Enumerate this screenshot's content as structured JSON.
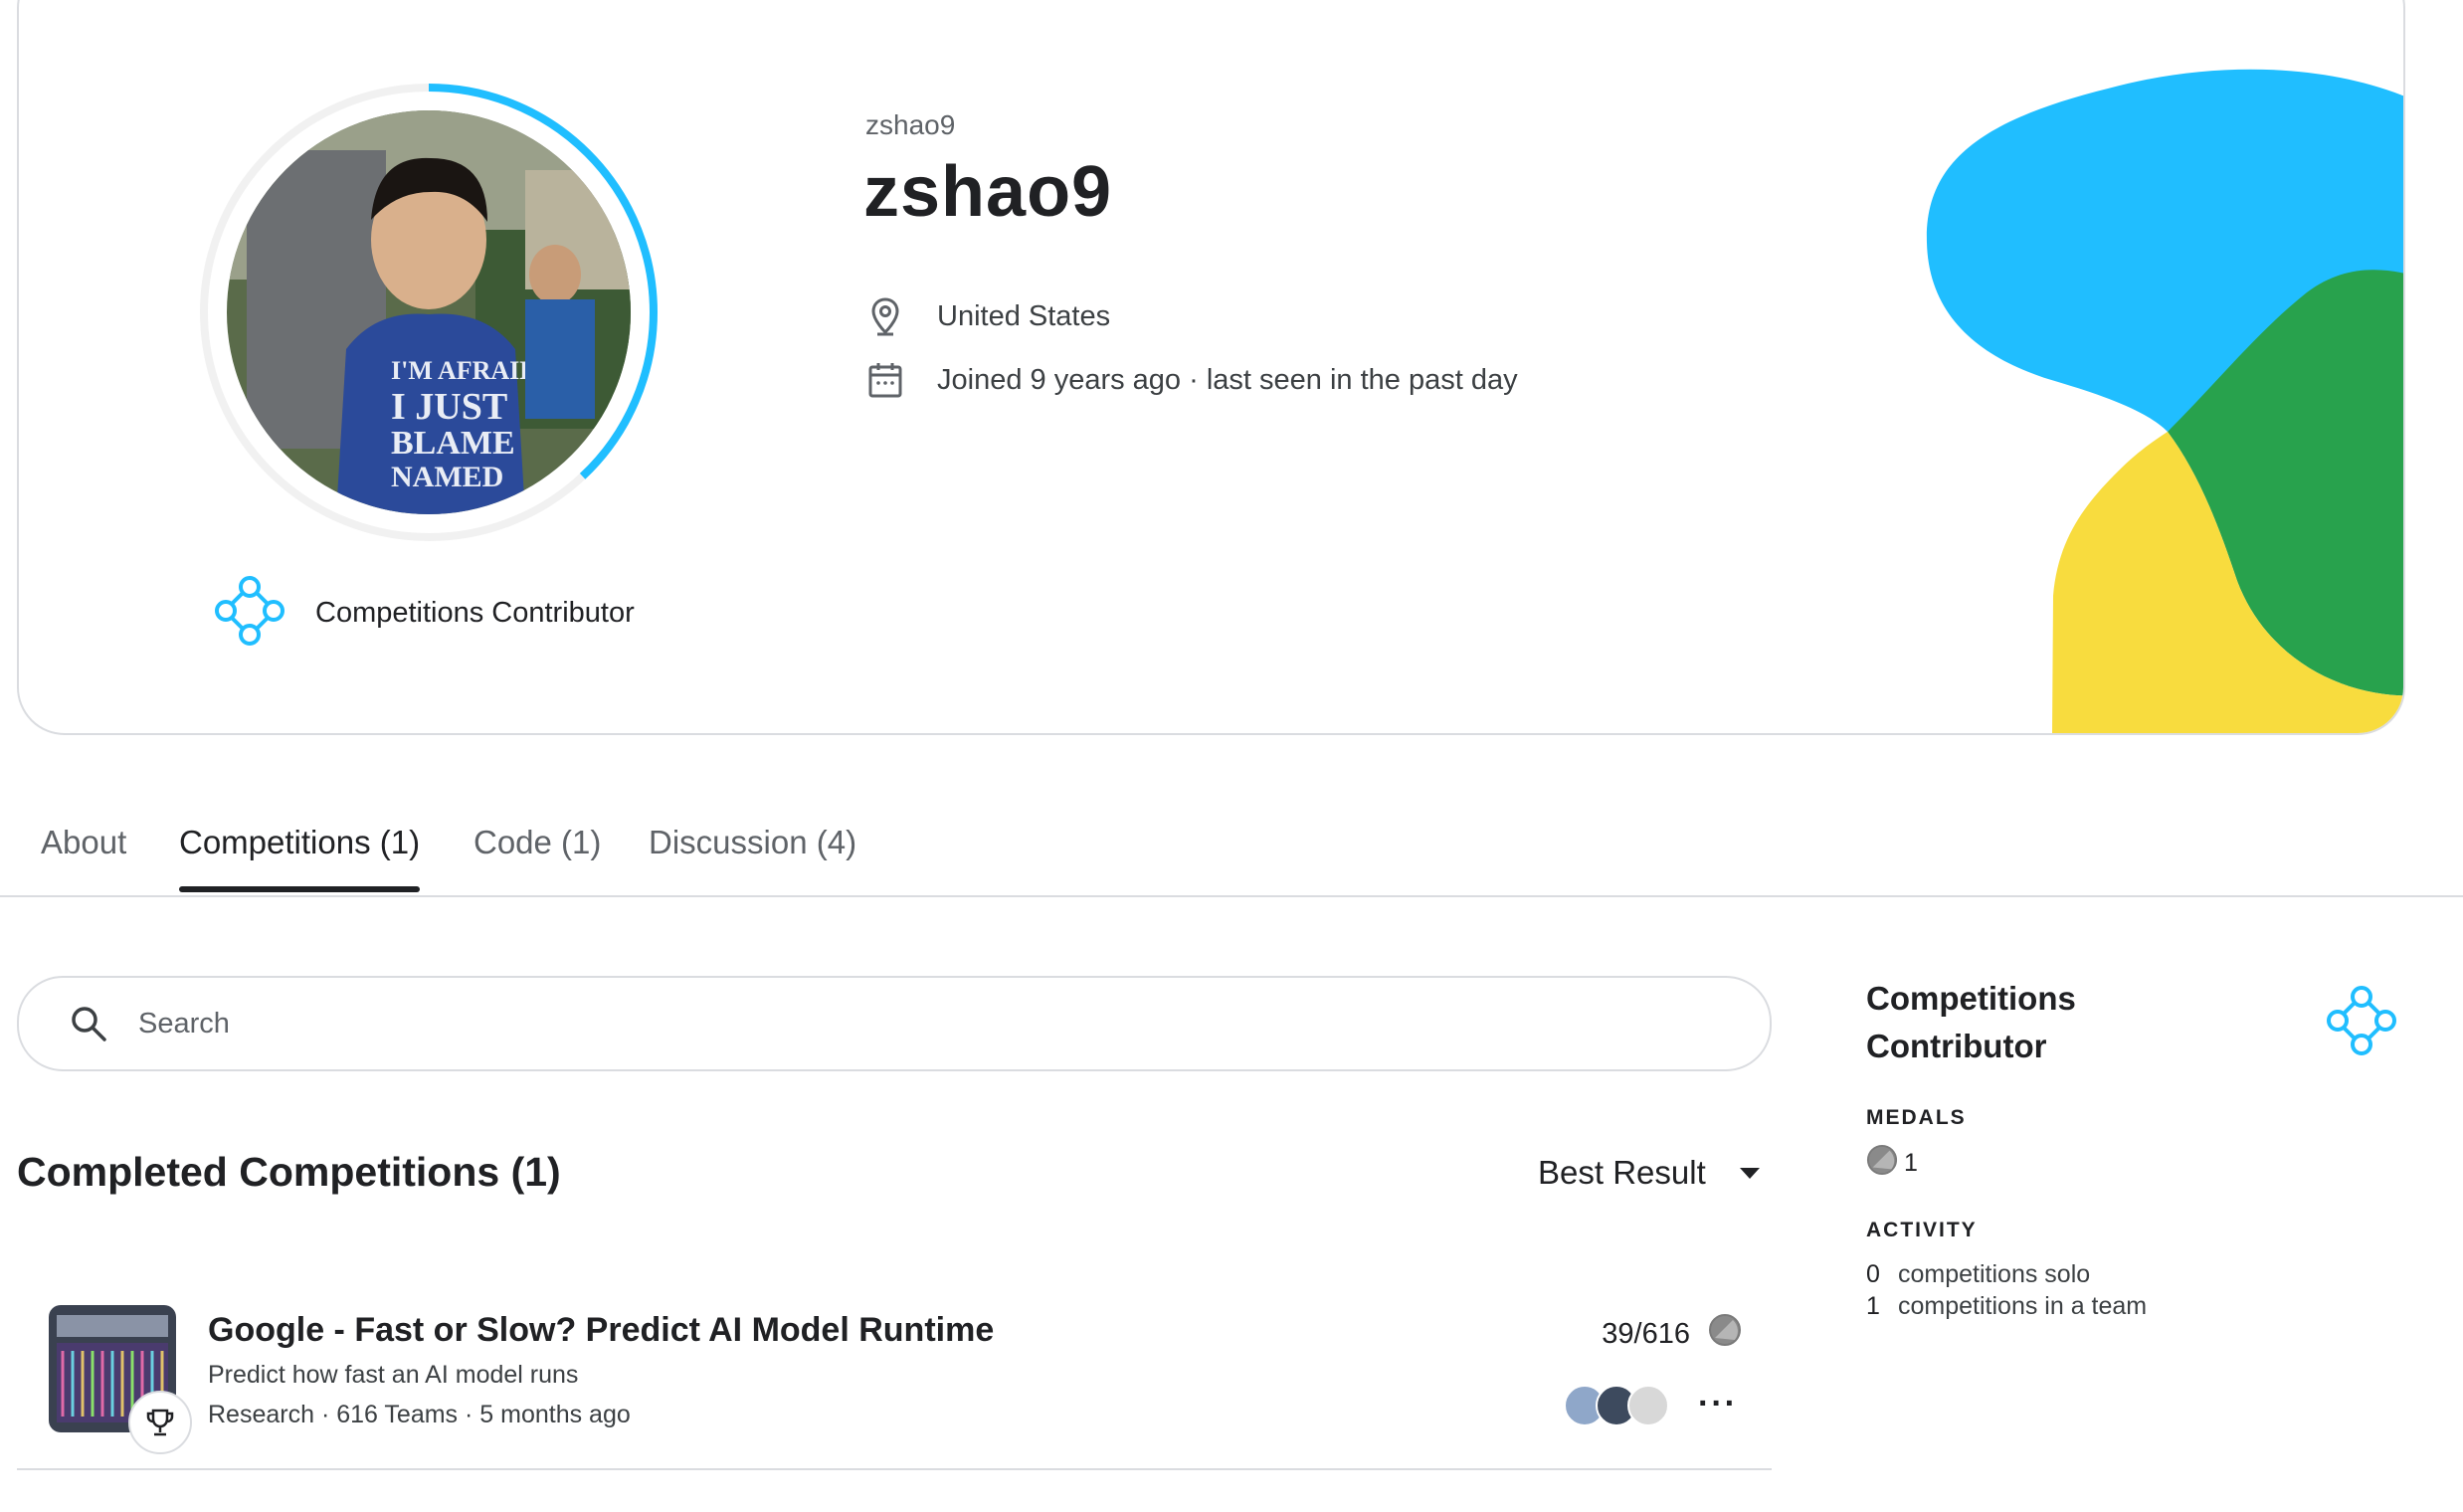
{
  "profile": {
    "handle_small": "zshao9",
    "display_name": "zshao9",
    "location": "United States",
    "joined": "Joined 9 years ago · last seen in the past day",
    "tier": "Competitions Contributor",
    "progress_fraction": 0.38
  },
  "tabs": [
    {
      "label": "About"
    },
    {
      "label": "Competitions (1)"
    },
    {
      "label": "Code (1)"
    },
    {
      "label": "Discussion (4)"
    }
  ],
  "search": {
    "placeholder": "Search"
  },
  "section": {
    "title": "Completed Competitions (1)",
    "sort_label": "Best Result"
  },
  "competitions": [
    {
      "title": "Google - Fast or Slow? Predict AI Model Runtime",
      "subtitle": "Predict how fast an AI model runs",
      "meta": "Research · 616 Teams · 5 months ago",
      "rank": "39/616",
      "more": "···"
    }
  ],
  "sidebar": {
    "title": "Competitions Contributor",
    "medals_caption": "MEDALS",
    "medal_count": "1",
    "activity_caption": "ACTIVITY",
    "activity": [
      {
        "count": "0",
        "label": "competitions solo"
      },
      {
        "count": "1",
        "label": "competitions in a team"
      }
    ]
  },
  "colors": {
    "accent_blue": "#20beff",
    "green": "#28a24d",
    "yellow": "#f8dc3e",
    "text": "#202124",
    "muted": "#5f6368",
    "border": "#dadce0"
  },
  "icons": [
    "location-pin-icon",
    "calendar-icon",
    "tier-contributor-icon",
    "search-icon",
    "dropdown-caret-icon",
    "trophy-icon",
    "bronze-medal-icon",
    "more-icon"
  ]
}
